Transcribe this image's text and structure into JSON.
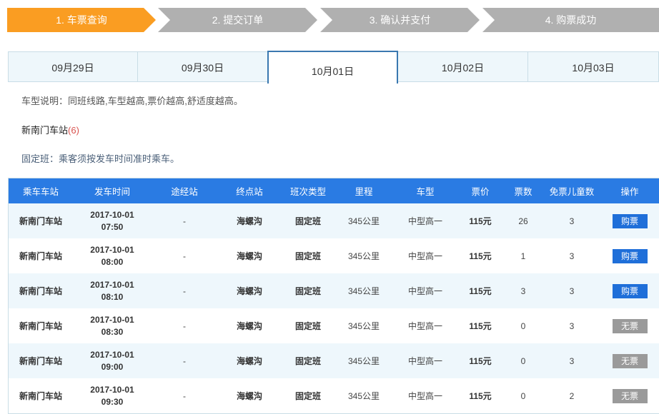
{
  "steps": [
    {
      "label": "1. 车票查询",
      "active": true
    },
    {
      "label": "2. 提交订单",
      "active": false
    },
    {
      "label": "3. 确认并支付",
      "active": false
    },
    {
      "label": "4. 购票成功",
      "active": false
    }
  ],
  "dates": [
    {
      "label": "09月29日",
      "selected": false
    },
    {
      "label": "09月30日",
      "selected": false
    },
    {
      "label": "10月01日",
      "selected": true
    },
    {
      "label": "10月02日",
      "selected": false
    },
    {
      "label": "10月03日",
      "selected": false
    }
  ],
  "info": {
    "desc": "车型说明：同班线路,车型越高,票价越高,舒适度越高。",
    "station_name": "新南门车站",
    "station_count": "(6)",
    "fixed_note": "固定班：乘客须按发车时间准时乘车。"
  },
  "table": {
    "headers": [
      "乘车车站",
      "发车时间",
      "途经站",
      "终点站",
      "班次类型",
      "里程",
      "车型",
      "票价",
      "票数",
      "免票儿童数",
      "操作"
    ],
    "rows": [
      {
        "station": "新南门车站",
        "date": "2017-10-01",
        "time": "07:50",
        "via": "-",
        "dest": "海螺沟",
        "type": "固定班",
        "distance": "345公里",
        "model": "中型高一",
        "price": "115元",
        "tickets": "26",
        "children": "3",
        "action": "购票",
        "available": true
      },
      {
        "station": "新南门车站",
        "date": "2017-10-01",
        "time": "08:00",
        "via": "-",
        "dest": "海螺沟",
        "type": "固定班",
        "distance": "345公里",
        "model": "中型高一",
        "price": "115元",
        "tickets": "1",
        "children": "3",
        "action": "购票",
        "available": true
      },
      {
        "station": "新南门车站",
        "date": "2017-10-01",
        "time": "08:10",
        "via": "-",
        "dest": "海螺沟",
        "type": "固定班",
        "distance": "345公里",
        "model": "中型高一",
        "price": "115元",
        "tickets": "3",
        "children": "3",
        "action": "购票",
        "available": true
      },
      {
        "station": "新南门车站",
        "date": "2017-10-01",
        "time": "08:30",
        "via": "-",
        "dest": "海螺沟",
        "type": "固定班",
        "distance": "345公里",
        "model": "中型高一",
        "price": "115元",
        "tickets": "0",
        "children": "3",
        "action": "无票",
        "available": false
      },
      {
        "station": "新南门车站",
        "date": "2017-10-01",
        "time": "09:00",
        "via": "-",
        "dest": "海螺沟",
        "type": "固定班",
        "distance": "345公里",
        "model": "中型高一",
        "price": "115元",
        "tickets": "0",
        "children": "3",
        "action": "无票",
        "available": false
      },
      {
        "station": "新南门车站",
        "date": "2017-10-01",
        "time": "09:30",
        "via": "-",
        "dest": "海螺沟",
        "type": "固定班",
        "distance": "345公里",
        "model": "中型高一",
        "price": "115元",
        "tickets": "0",
        "children": "2",
        "action": "无票",
        "available": false
      }
    ]
  },
  "colors": {
    "step_active": "#fa9d22",
    "step_inactive": "#b0b0b0",
    "table_header": "#2a7be3",
    "buy_button": "#1f6fd9",
    "no_ticket_button": "#9a9a9a",
    "count_red": "#d9534f"
  }
}
